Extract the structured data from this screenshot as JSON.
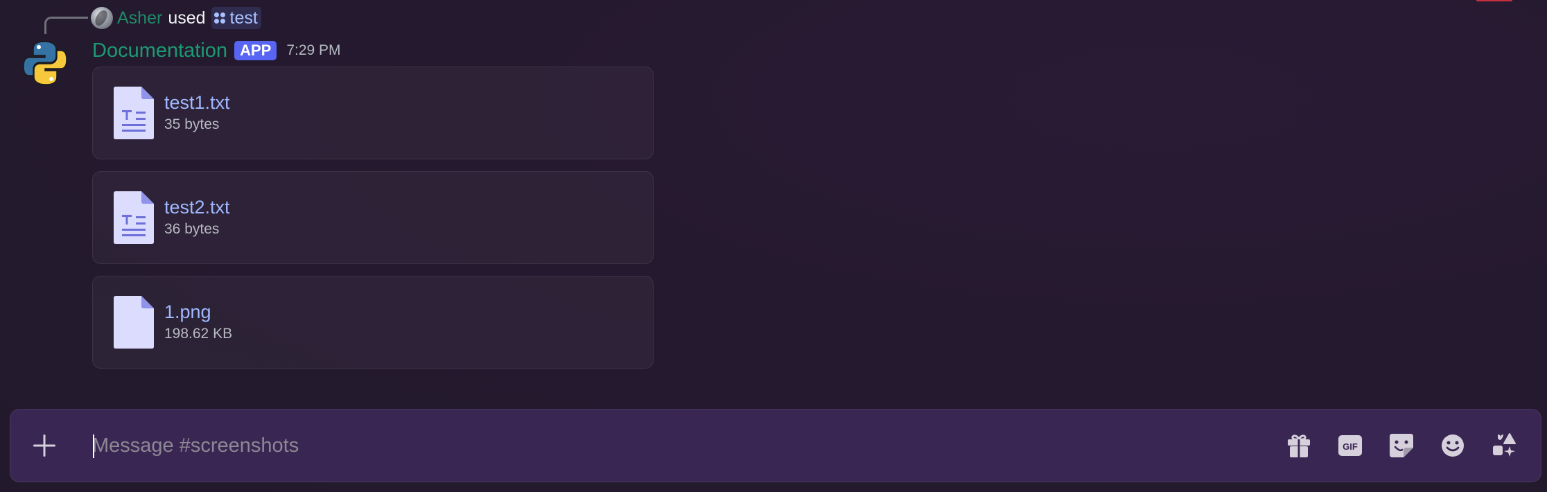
{
  "command_row": {
    "user": "Asher",
    "verb": "used",
    "command": "test"
  },
  "message": {
    "author": "Documentation",
    "tag": "APP",
    "time": "7:29 PM"
  },
  "attachments": [
    {
      "name": "test1.txt",
      "size": "35 bytes",
      "icon": "text-file-icon"
    },
    {
      "name": "test2.txt",
      "size": "36 bytes",
      "icon": "text-file-icon"
    },
    {
      "name": "1.png",
      "size": "198.62 KB",
      "icon": "blank-file-icon"
    }
  ],
  "composer": {
    "placeholder": "Message #screenshots",
    "buttons": [
      "upload-plus",
      "gift",
      "gif",
      "sticker",
      "emoji",
      "apps"
    ],
    "gif_label": "GIF"
  },
  "colors": {
    "bot_name": "#1c9a72",
    "link": "#a0b8ff",
    "app_tag": "#5865f2",
    "composer_bg": "#3a2652"
  }
}
